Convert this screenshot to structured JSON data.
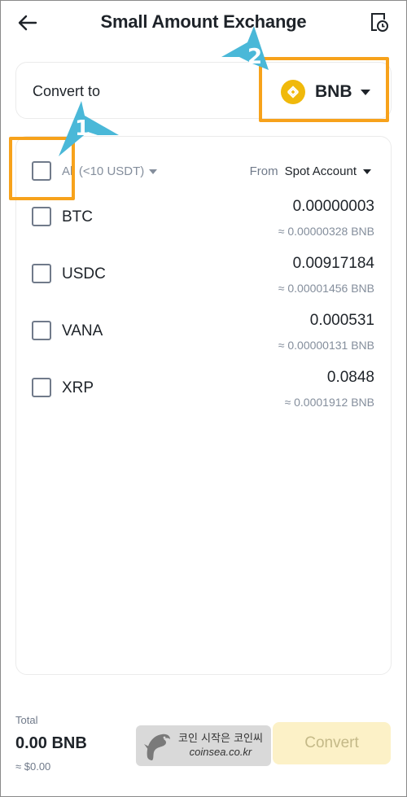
{
  "header": {
    "title": "Small Amount Exchange",
    "back_icon": "arrow-left-icon",
    "history_icon": "history-clock-icon"
  },
  "convert_to": {
    "label": "Convert to",
    "coin": "BNB",
    "coin_icon": "bnb-logo-icon"
  },
  "list_header": {
    "all_label": "All (<10 USDT)",
    "from_label": "From",
    "account": "Spot Account"
  },
  "assets": [
    {
      "name": "BTC",
      "amount": "0.00000003",
      "estimate": "≈ 0.00000328 BNB",
      "checked": false
    },
    {
      "name": "USDC",
      "amount": "0.00917184",
      "estimate": "≈ 0.00001456 BNB",
      "checked": false
    },
    {
      "name": "VANA",
      "amount": "0.000531",
      "estimate": "≈ 0.00000131 BNB",
      "checked": false
    },
    {
      "name": "XRP",
      "amount": "0.0848",
      "estimate": "≈ 0.0001912 BNB",
      "checked": false
    }
  ],
  "footer": {
    "total_label": "Total",
    "total_value": "0.00 BNB",
    "total_usd": "≈ $0.00",
    "convert_label": "Convert"
  },
  "watermark": {
    "line1": "코인 시작은 코인씨",
    "line2": "coinsea.co.kr"
  },
  "annotations": {
    "callout_1": "1",
    "callout_2": "2",
    "highlight_color": "#f7a21b",
    "callout_color": "#4ab8d8"
  },
  "colors": {
    "brand": "#f0b90b",
    "convert_button_disabled_bg": "#fcf1c7",
    "text_primary": "#1e2329",
    "text_secondary": "#848e9c"
  }
}
